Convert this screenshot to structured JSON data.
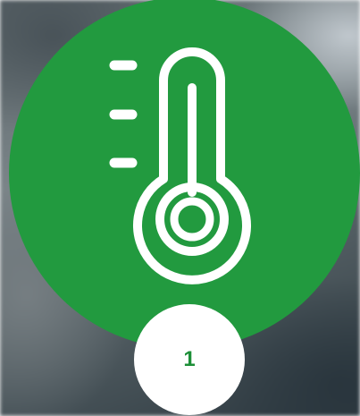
{
  "icon": {
    "name": "thermometer-icon",
    "color": "#ffffff"
  },
  "circle": {
    "color": "#229a3f"
  },
  "badge": {
    "number": "1",
    "background": "#ffffff",
    "text_color": "#1d8f38"
  }
}
